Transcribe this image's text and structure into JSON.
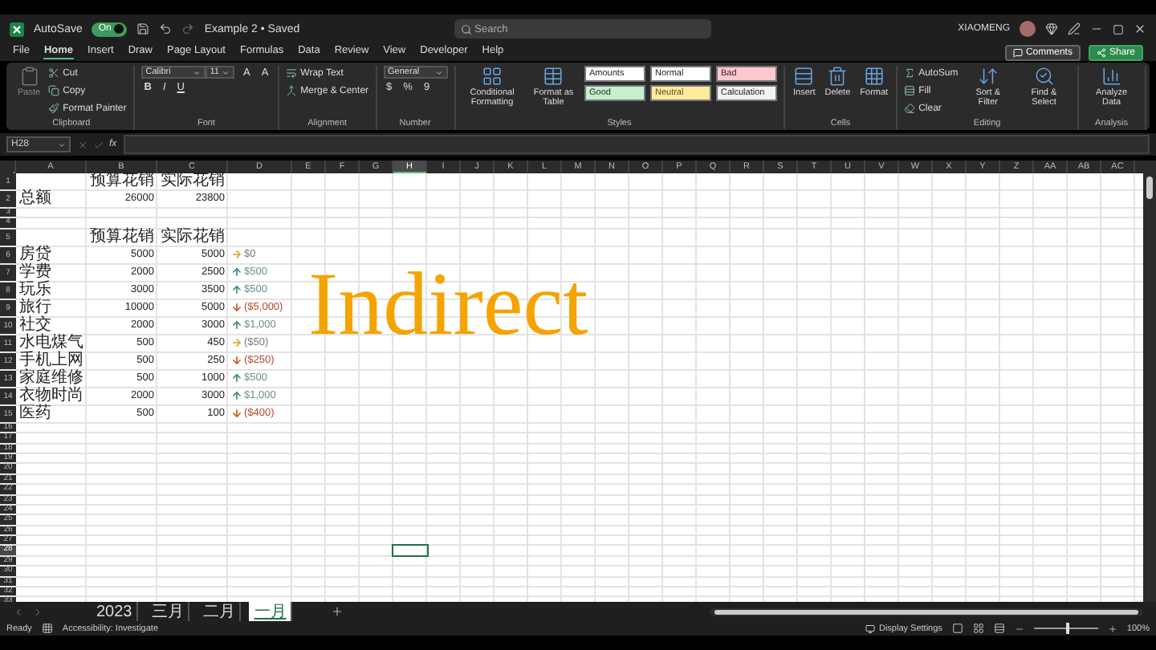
{
  "window": {
    "autosave_label": "AutoSave",
    "autosave_on": true,
    "autosave_state": "On",
    "title": "Example 2 • Saved",
    "search_placeholder": "Search",
    "user": "XIAOMENG"
  },
  "menu_tabs": [
    {
      "label": "File",
      "selected": false
    },
    {
      "label": "Home",
      "selected": true
    },
    {
      "label": "Insert",
      "selected": false
    },
    {
      "label": "Draw",
      "selected": false
    },
    {
      "label": "Page Layout",
      "selected": false
    },
    {
      "label": "Formulas",
      "selected": false
    },
    {
      "label": "Data",
      "selected": false
    },
    {
      "label": "Review",
      "selected": false
    },
    {
      "label": "View",
      "selected": false
    },
    {
      "label": "Developer",
      "selected": false
    },
    {
      "label": "Help",
      "selected": false
    }
  ],
  "actions": [
    {
      "label": "Comments",
      "kind": "outline"
    },
    {
      "label": "Share",
      "kind": "primary"
    }
  ],
  "ribbon": [
    {
      "label": "Clipboard",
      "columns": [
        {
          "kind": "large",
          "label": "Paste",
          "disabled": true
        },
        {
          "kind": "rows",
          "rows": [
            [
              {
                "kind": "button",
                "label": "Cut"
              }
            ],
            [
              {
                "kind": "button",
                "label": "Copy"
              }
            ],
            [
              {
                "kind": "button",
                "label": "Format Painter"
              }
            ]
          ]
        }
      ]
    },
    {
      "label": "Font",
      "columns": [
        {
          "kind": "rows",
          "rows": [
            [
              {
                "kind": "field",
                "value": "Calibri"
              }
            ],
            [
              {
                "kind": "glyph",
                "label": "B"
              },
              {
                "kind": "glyph",
                "label": "I"
              },
              {
                "kind": "glyph",
                "label": "U"
              }
            ]
          ]
        },
        {
          "kind": "rows",
          "rows": [
            [
              {
                "kind": "field",
                "value": "11"
              },
              {
                "kind": "glyph",
                "label": "A"
              },
              {
                "kind": "glyph",
                "label": "A"
              }
            ]
          ]
        }
      ]
    },
    {
      "label": "Alignment",
      "columns": [
        {
          "kind": "rows",
          "rows": [
            [
              {
                "kind": "button",
                "label": "Wrap Text"
              }
            ],
            [
              {
                "kind": "button",
                "label": "Merge & Center"
              }
            ]
          ]
        }
      ]
    },
    {
      "label": "Number",
      "columns": [
        {
          "kind": "rows",
          "rows": [
            [
              {
                "kind": "field",
                "value": "General"
              }
            ],
            [
              {
                "kind": "glyph",
                "label": "$"
              },
              {
                "kind": "glyph",
                "label": "%"
              },
              {
                "kind": "glyph",
                "label": "9"
              }
            ]
          ]
        }
      ]
    },
    {
      "label": "Styles",
      "columns": [
        {
          "kind": "large",
          "label": "Conditional Formatting",
          "disabled": false
        },
        {
          "kind": "large",
          "label": "Format as Table",
          "disabled": false
        },
        {
          "kind": "rows",
          "rows": [
            [
              {
                "kind": "style",
                "label": "Amounts",
                "color": "#ffffff"
              },
              {
                "kind": "style",
                "label": "Normal",
                "color": "#ffffff"
              },
              {
                "kind": "style",
                "label": "Bad",
                "color": "#ffc7ce"
              }
            ],
            [
              {
                "kind": "style",
                "label": "Good",
                "color": "#c6efce"
              },
              {
                "kind": "style",
                "label": "Neutral",
                "color": "#ffeb9c"
              },
              {
                "kind": "style",
                "label": "Calculation",
                "color": "#f2f2f2"
              }
            ]
          ]
        }
      ]
    },
    {
      "label": "Cells",
      "columns": [
        {
          "kind": "large",
          "label": "Insert",
          "disabled": false
        },
        {
          "kind": "large",
          "label": "Delete",
          "disabled": false
        },
        {
          "kind": "large",
          "label": "Format",
          "disabled": false
        }
      ]
    },
    {
      "label": "Editing",
      "columns": [
        {
          "kind": "rows",
          "rows": [
            [
              {
                "kind": "button",
                "label": "AutoSum"
              }
            ],
            [
              {
                "kind": "button",
                "label": "Fill"
              }
            ],
            [
              {
                "kind": "button",
                "label": "Clear"
              }
            ]
          ]
        },
        {
          "kind": "large",
          "label": "Sort & Filter",
          "disabled": false
        },
        {
          "kind": "large",
          "label": "Find & Select",
          "disabled": false
        }
      ]
    },
    {
      "label": "Analysis",
      "columns": [
        {
          "kind": "large",
          "label": "Analyze Data",
          "disabled": false
        }
      ]
    }
  ],
  "formula_bar": {
    "name_box": "H28",
    "fx_label": "fx"
  },
  "columns": [
    {
      "label": "A",
      "selected": false
    },
    {
      "label": "B",
      "selected": false
    },
    {
      "label": "C",
      "selected": false
    },
    {
      "label": "D",
      "selected": false
    },
    {
      "label": "E",
      "selected": false
    },
    {
      "label": "F",
      "selected": false
    },
    {
      "label": "G",
      "selected": false
    },
    {
      "label": "H",
      "selected": true
    },
    {
      "label": "I",
      "selected": false
    },
    {
      "label": "J",
      "selected": false
    },
    {
      "label": "K",
      "selected": false
    },
    {
      "label": "L",
      "selected": false
    },
    {
      "label": "M",
      "selected": false
    },
    {
      "label": "N",
      "selected": false
    },
    {
      "label": "O",
      "selected": false
    },
    {
      "label": "P",
      "selected": false
    },
    {
      "label": "Q",
      "selected": false
    },
    {
      "label": "R",
      "selected": false
    },
    {
      "label": "S",
      "selected": false
    },
    {
      "label": "T",
      "selected": false
    },
    {
      "label": "U",
      "selected": false
    },
    {
      "label": "V",
      "selected": false
    },
    {
      "label": "W",
      "selected": false
    },
    {
      "label": "X",
      "selected": false
    },
    {
      "label": "Y",
      "selected": false
    },
    {
      "label": "Z",
      "selected": false
    },
    {
      "label": "AA",
      "selected": false
    },
    {
      "label": "AB",
      "selected": false
    },
    {
      "label": "AC",
      "selected": false
    }
  ],
  "rows": [
    {
      "label": "1",
      "selected": false,
      "b": "预算花销",
      "c": "实际花销"
    },
    {
      "label": "2",
      "selected": false,
      "a": "总额",
      "b": "26000",
      "c": "23800"
    },
    {
      "label": "3",
      "selected": false
    },
    {
      "label": "4",
      "selected": false
    },
    {
      "label": "5",
      "selected": false,
      "b": "预算花销",
      "c": "实际花销"
    },
    {
      "label": "6",
      "selected": false,
      "a": "房贷",
      "b": "5000",
      "c": "5000",
      "d": {
        "kind": "flat",
        "text": "$0"
      }
    },
    {
      "label": "7",
      "selected": false,
      "a": "学费",
      "b": "2000",
      "c": "2500",
      "d": {
        "kind": "up",
        "text": "$500"
      }
    },
    {
      "label": "8",
      "selected": false,
      "a": "玩乐",
      "b": "3000",
      "c": "3500",
      "d": {
        "kind": "up",
        "text": "$500"
      }
    },
    {
      "label": "9",
      "selected": false,
      "a": "旅行",
      "b": "10000",
      "c": "5000",
      "d": {
        "kind": "down",
        "text": "($5,000)"
      }
    },
    {
      "label": "10",
      "selected": false,
      "a": "社交",
      "b": "2000",
      "c": "3000",
      "d": {
        "kind": "up",
        "text": "$1,000"
      }
    },
    {
      "label": "11",
      "selected": false,
      "a": "水电煤气",
      "b": "500",
      "c": "450",
      "d": {
        "kind": "flat",
        "text": "($50)"
      }
    },
    {
      "label": "12",
      "selected": false,
      "a": "手机上网",
      "b": "500",
      "c": "250",
      "d": {
        "kind": "down",
        "text": "($250)"
      }
    },
    {
      "label": "13",
      "selected": false,
      "a": "家庭维修",
      "b": "500",
      "c": "1000",
      "d": {
        "kind": "up",
        "text": "$500"
      }
    },
    {
      "label": "14",
      "selected": false,
      "a": "衣物时尚",
      "b": "2000",
      "c": "3000",
      "d": {
        "kind": "up",
        "text": "$1,000"
      }
    },
    {
      "label": "15",
      "selected": false,
      "a": "医药",
      "b": "500",
      "c": "100",
      "d": {
        "kind": "down",
        "text": "($400)"
      }
    },
    {
      "label": "16",
      "selected": false
    },
    {
      "label": "17",
      "selected": false
    },
    {
      "label": "18",
      "selected": false
    },
    {
      "label": "19",
      "selected": false
    },
    {
      "label": "20",
      "selected": false
    },
    {
      "label": "21",
      "selected": false
    },
    {
      "label": "22",
      "selected": false
    },
    {
      "label": "23",
      "selected": false
    },
    {
      "label": "24",
      "selected": false
    },
    {
      "label": "25",
      "selected": false
    },
    {
      "label": "26",
      "selected": false
    },
    {
      "label": "27",
      "selected": false
    },
    {
      "label": "28",
      "selected": true
    },
    {
      "label": "29",
      "selected": false
    },
    {
      "label": "30",
      "selected": false
    },
    {
      "label": "31",
      "selected": false
    },
    {
      "label": "32",
      "selected": false
    },
    {
      "label": "33",
      "selected": false
    }
  ],
  "overlay_text": "Indirect",
  "sheet_tabs": [
    {
      "label": "2023",
      "selected": false
    },
    {
      "label": "三月",
      "selected": false
    },
    {
      "label": "二月",
      "selected": false
    },
    {
      "label": "一月",
      "selected": true
    }
  ],
  "status_bar": {
    "ready": "Ready",
    "accessibility": "Accessibility: Investigate",
    "display_settings": "Display Settings",
    "zoom_slider": {
      "level": 0.5
    },
    "zoom": "100%"
  }
}
